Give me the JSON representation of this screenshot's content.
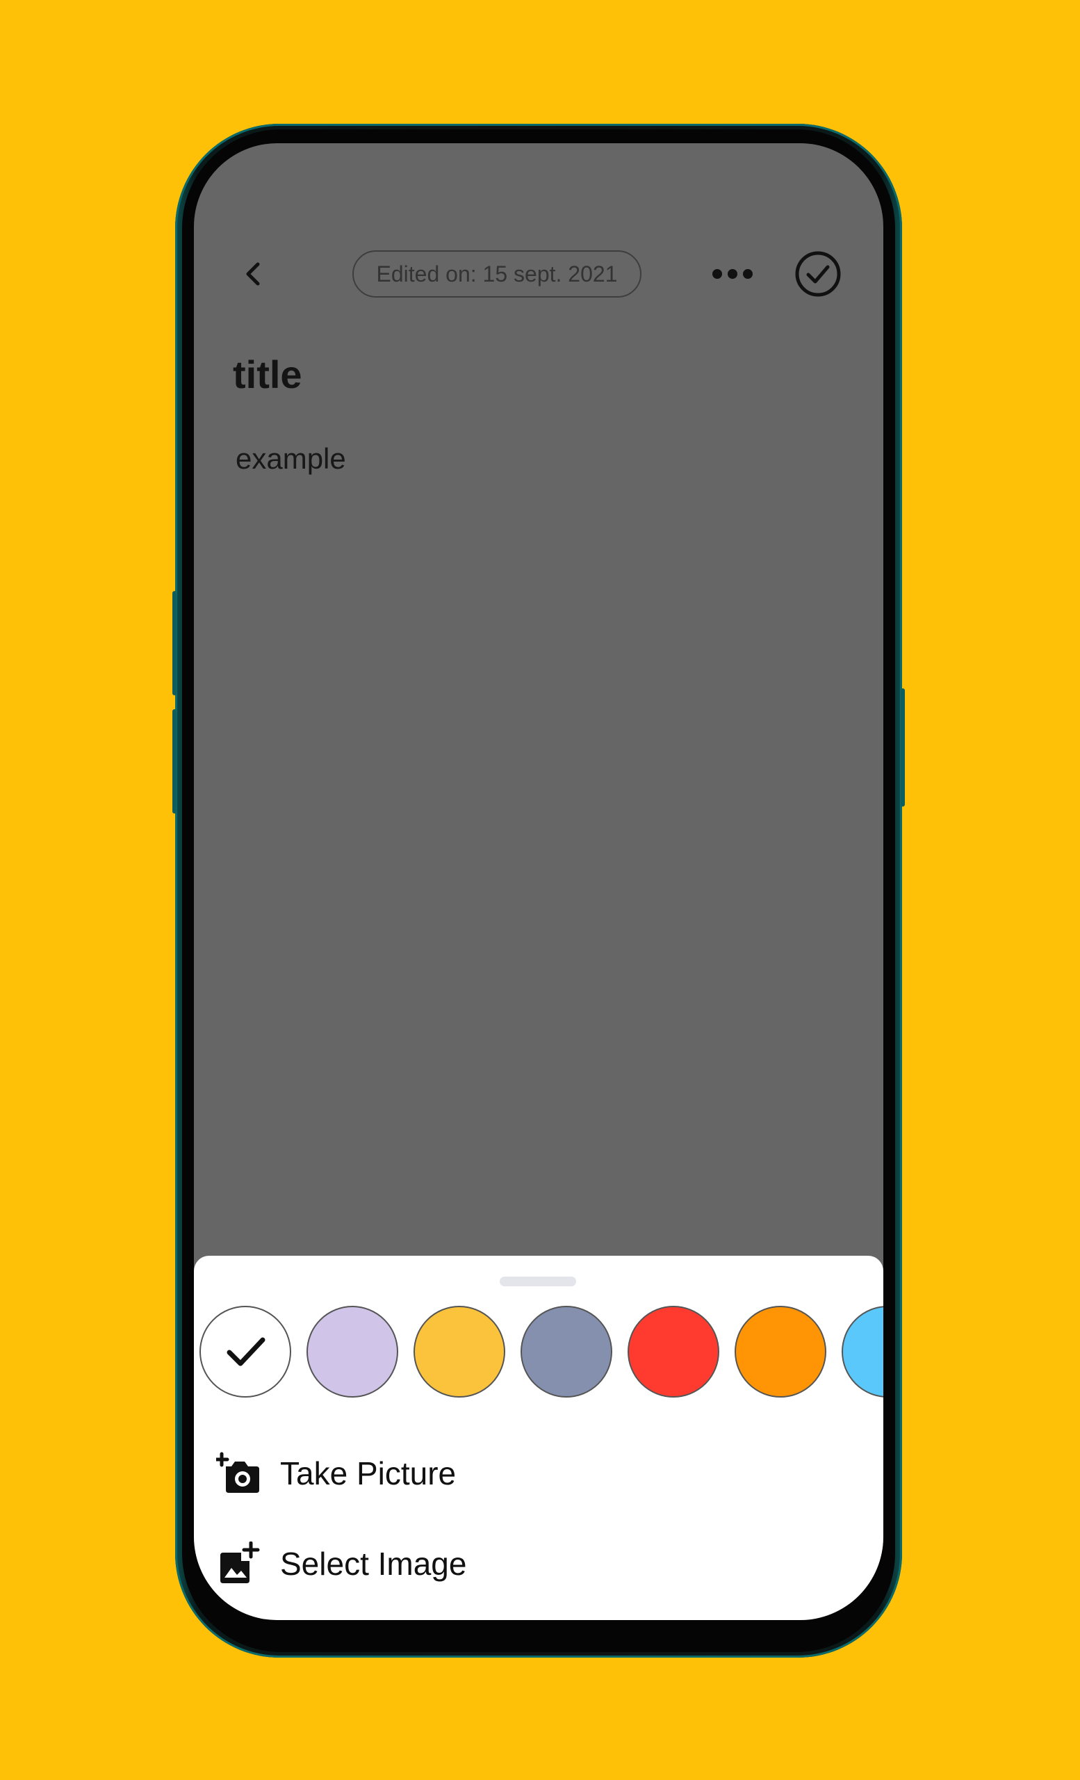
{
  "header": {
    "edited_label": "Edited on: 15 sept. 2021"
  },
  "note": {
    "title": "title",
    "body": "example"
  },
  "color_picker": {
    "swatches": [
      {
        "name": "white",
        "color": "#FFFFFF",
        "selected": true
      },
      {
        "name": "lavender",
        "color": "#D1C4E9",
        "selected": false
      },
      {
        "name": "amber",
        "color": "#FBC23C",
        "selected": false
      },
      {
        "name": "slate-blue",
        "color": "#8590AF",
        "selected": false
      },
      {
        "name": "red",
        "color": "#FF3B30",
        "selected": false
      },
      {
        "name": "orange",
        "color": "#FF9505",
        "selected": false
      },
      {
        "name": "sky-blue",
        "color": "#5AC8FA",
        "selected": false
      }
    ]
  },
  "actions": {
    "take_picture": "Take Picture",
    "select_image": "Select Image"
  },
  "theme": {
    "background": "#FFC107",
    "overlay": "#666666",
    "sheet": "#FFFFFF"
  }
}
